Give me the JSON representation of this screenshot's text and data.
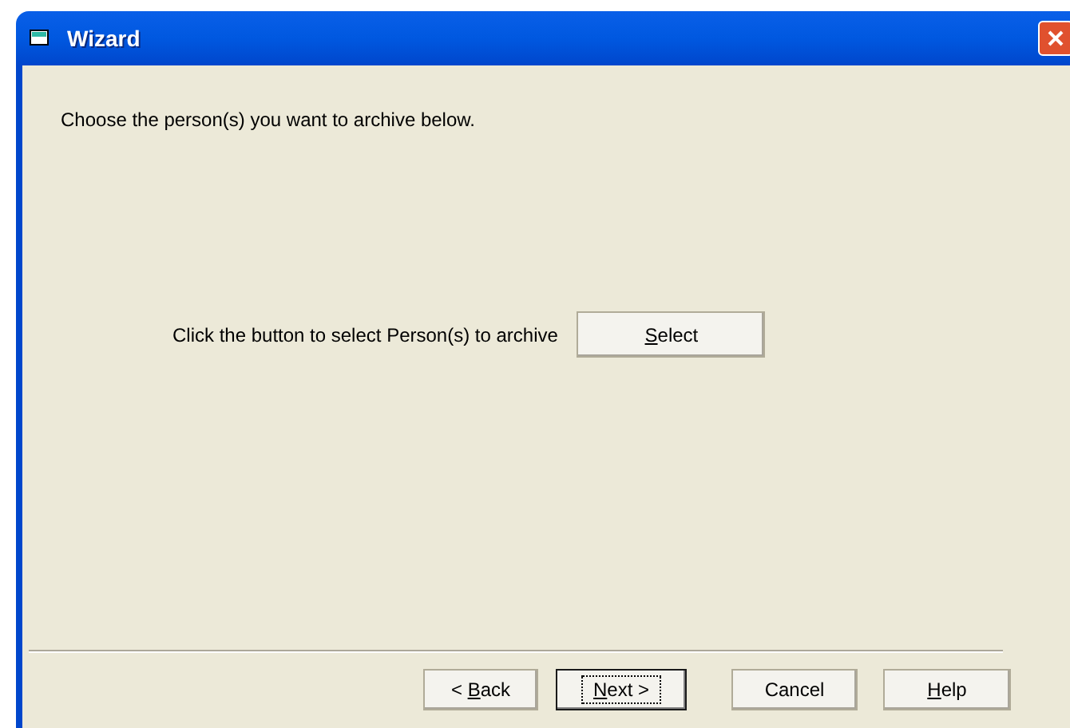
{
  "window": {
    "title": "Wizard"
  },
  "instruction": "Choose the person(s) you want to archive below.",
  "select_row": {
    "label": "Click the button to select Person(s) to archive",
    "button": {
      "key": "S",
      "after": "elect"
    }
  },
  "buttons": [
    {
      "before": "< ",
      "key": "B",
      "after": "ack",
      "default": false
    },
    {
      "key": "N",
      "after": "ext >",
      "default": true
    },
    {
      "before": "Cancel",
      "default": false
    },
    {
      "key": "H",
      "after": "elp",
      "default": false
    }
  ]
}
